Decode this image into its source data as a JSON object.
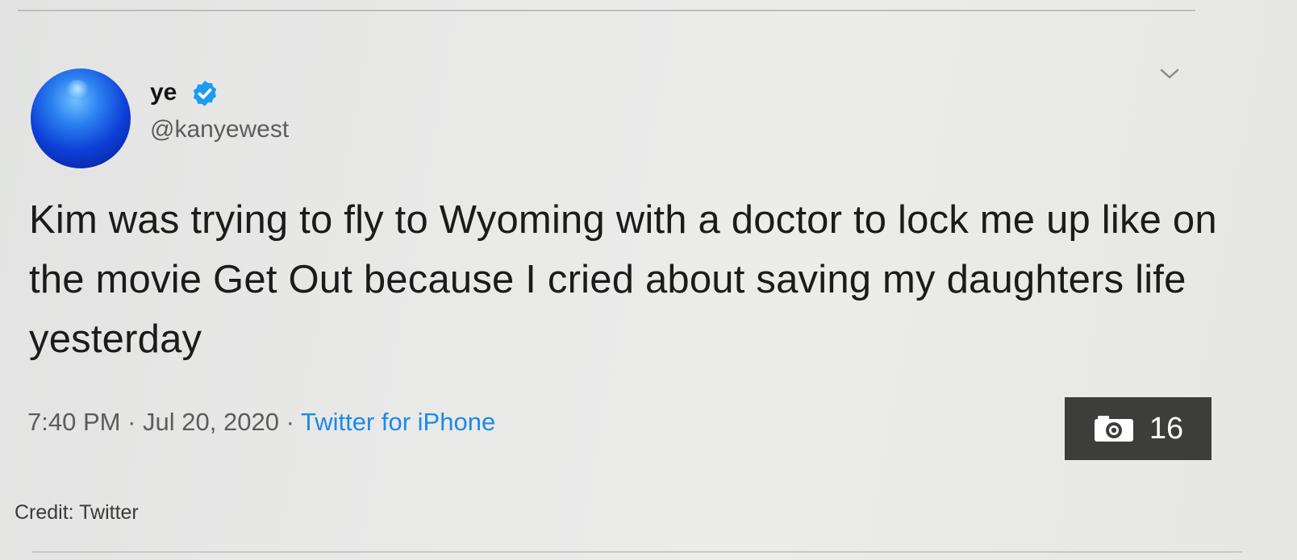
{
  "tweet": {
    "display_name": "ye",
    "handle": "@kanyewest",
    "verified": true,
    "text": "Kim was trying to fly to Wyoming with a doctor to lock me up like on the movie Get Out because I cried about saving my daughters life yesterday",
    "time": "7:40 PM",
    "separator": "·",
    "date": "Jul 20, 2020",
    "source": "Twitter for iPhone"
  },
  "photo_badge": {
    "count": "16",
    "icon": "camera-icon"
  },
  "credit": "Credit: Twitter",
  "colors": {
    "verified_blue": "#1d9bf0",
    "link_blue": "#1d8ae6",
    "badge_bg": "#3d3d3c"
  },
  "icons": [
    "avatar",
    "verified-badge-icon",
    "chevron-down-icon",
    "camera-icon"
  ]
}
